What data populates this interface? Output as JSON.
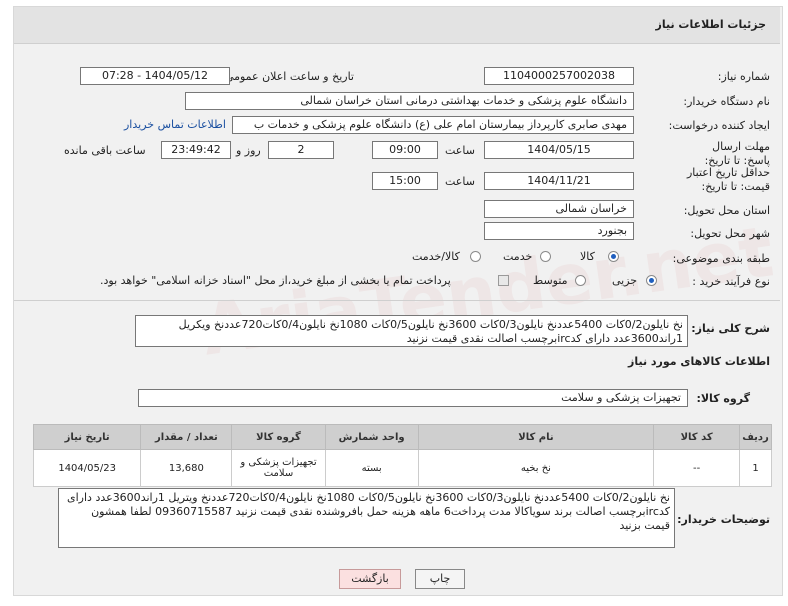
{
  "header": {
    "title": "جزئیات اطلاعات نیاز"
  },
  "fields": {
    "need_number_label": "شماره نیاز:",
    "need_number": "1104000257002038",
    "announce_label": "تاریخ و ساعت اعلان عمومی:",
    "announce_value": "1404/05/12 - 07:28",
    "buyer_org_label": "نام دستگاه خریدار:",
    "buyer_org": "دانشگاه علوم پزشکی و خدمات بهداشتی درمانی استان خراسان شمالی",
    "creator_label": "ایجاد کننده درخواست:",
    "creator": "مهدی صابری کارپرداز بیمارستان امام علی (ع) دانشگاه علوم پزشکی و خدمات ب",
    "buyer_contact_link": "اطلاعات تماس خریدار",
    "reply_deadline_label": "مهلت ارسال پاسخ: تا تاریخ:",
    "reply_date": "1404/05/15",
    "hour_label": "ساعت",
    "reply_time": "09:00",
    "days_count": "2",
    "days_label": "روز و",
    "remaining_time": "23:49:42",
    "remaining_label": "ساعت باقی مانده",
    "validity_label": "حداقل تاریخ اعتبار قیمت: تا تاریخ:",
    "validity_date": "1404/11/21",
    "validity_time": "15:00",
    "province_label": "استان محل تحویل:",
    "province": "خراسان شمالی",
    "city_label": "شهر محل تحویل:",
    "city": "بجنورد",
    "category_label": "طبقه بندی موضوعی:",
    "category_options": [
      "کالا",
      "خدمت",
      "کالا/خدمت"
    ],
    "process_label": "نوع فرآیند خرید :",
    "process_options": [
      "جزیی",
      "متوسط"
    ],
    "payment_note": "پرداخت تمام یا بخشی از مبلغ خرید،از محل \"اسناد خزانه اسلامی\" خواهد بود."
  },
  "description": {
    "label": "شرح کلی نیاز:",
    "text": "نخ نایلون0/2کات 5400عددنخ نایلون0/3کات 3600نخ نایلون0/5کات 1080نخ نایلون0/4کات720عددنخ ویکریل 1راند3600عدد دارای کدircبرچسب اصالت نقدی قیمت نزنید"
  },
  "goods_info": {
    "title": "اطلاعات کالاهای مورد نیاز",
    "group_label": "گروه کالا:",
    "group_value": "تجهیزات پزشکی و سلامت"
  },
  "table": {
    "headers": [
      "ردیف",
      "کد کالا",
      "نام کالا",
      "واحد شمارش",
      "گروه کالا",
      "تعداد / مقدار",
      "تاریخ نیاز"
    ],
    "rows": [
      [
        "1",
        "--",
        "نخ بخیه",
        "بسته",
        "تجهیزات پزشکی و سلامت",
        "13,680",
        "1404/05/23"
      ]
    ]
  },
  "buyer_notes": {
    "label": "توضیحات خریدار:",
    "text": "نخ نایلون0/2کات 5400عددنخ نایلون0/3کات 3600نخ نایلون0/5کات 1080نخ نایلون0/4کات720عددنخ ویتریل 1راند3600عدد دارای کدircبرچسب اصالت برند سویاکالا مدت پرداخت6 ماهه هزینه حمل بافروشنده نقدی قیمت نزنید 09360715587 لطفا همشون قیمت بزنید"
  },
  "buttons": {
    "print": "چاپ",
    "back": "بازگشت"
  }
}
